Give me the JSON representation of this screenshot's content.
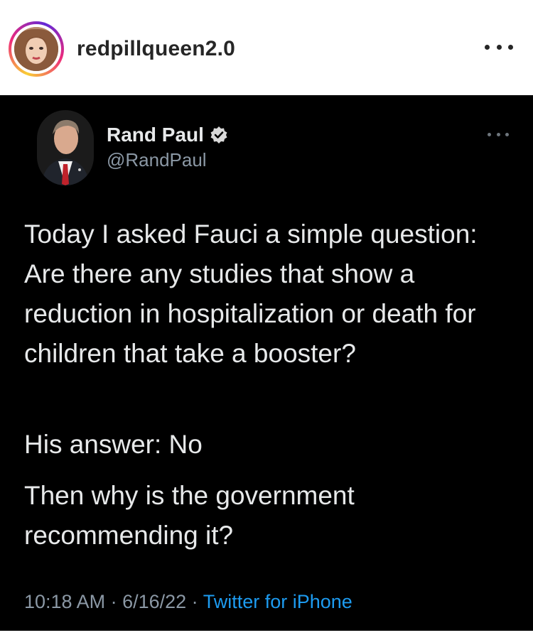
{
  "post": {
    "username": "redpillqueen2.0",
    "more_icon": "more-horizontal-icon"
  },
  "tweet": {
    "author_name": "Rand Paul",
    "author_handle": "@RandPaul",
    "verified": true,
    "paragraphs": [
      "Today I asked Fauci a simple question: Are there any studies that show a reduction in hospitalization or death for children that take a booster?",
      "His answer: No",
      "Then why is the government recommending it?"
    ],
    "time": "10:18 AM",
    "sep1": " · ",
    "date": "6/16/22",
    "sep2": " · ",
    "source": "Twitter for iPhone"
  },
  "colors": {
    "tweet_bg": "#000000",
    "tweet_text": "#e7e9ea",
    "meta_text": "#8b98a5",
    "link_blue": "#1d9bf0",
    "verified_badge": "#d9d9d9"
  }
}
